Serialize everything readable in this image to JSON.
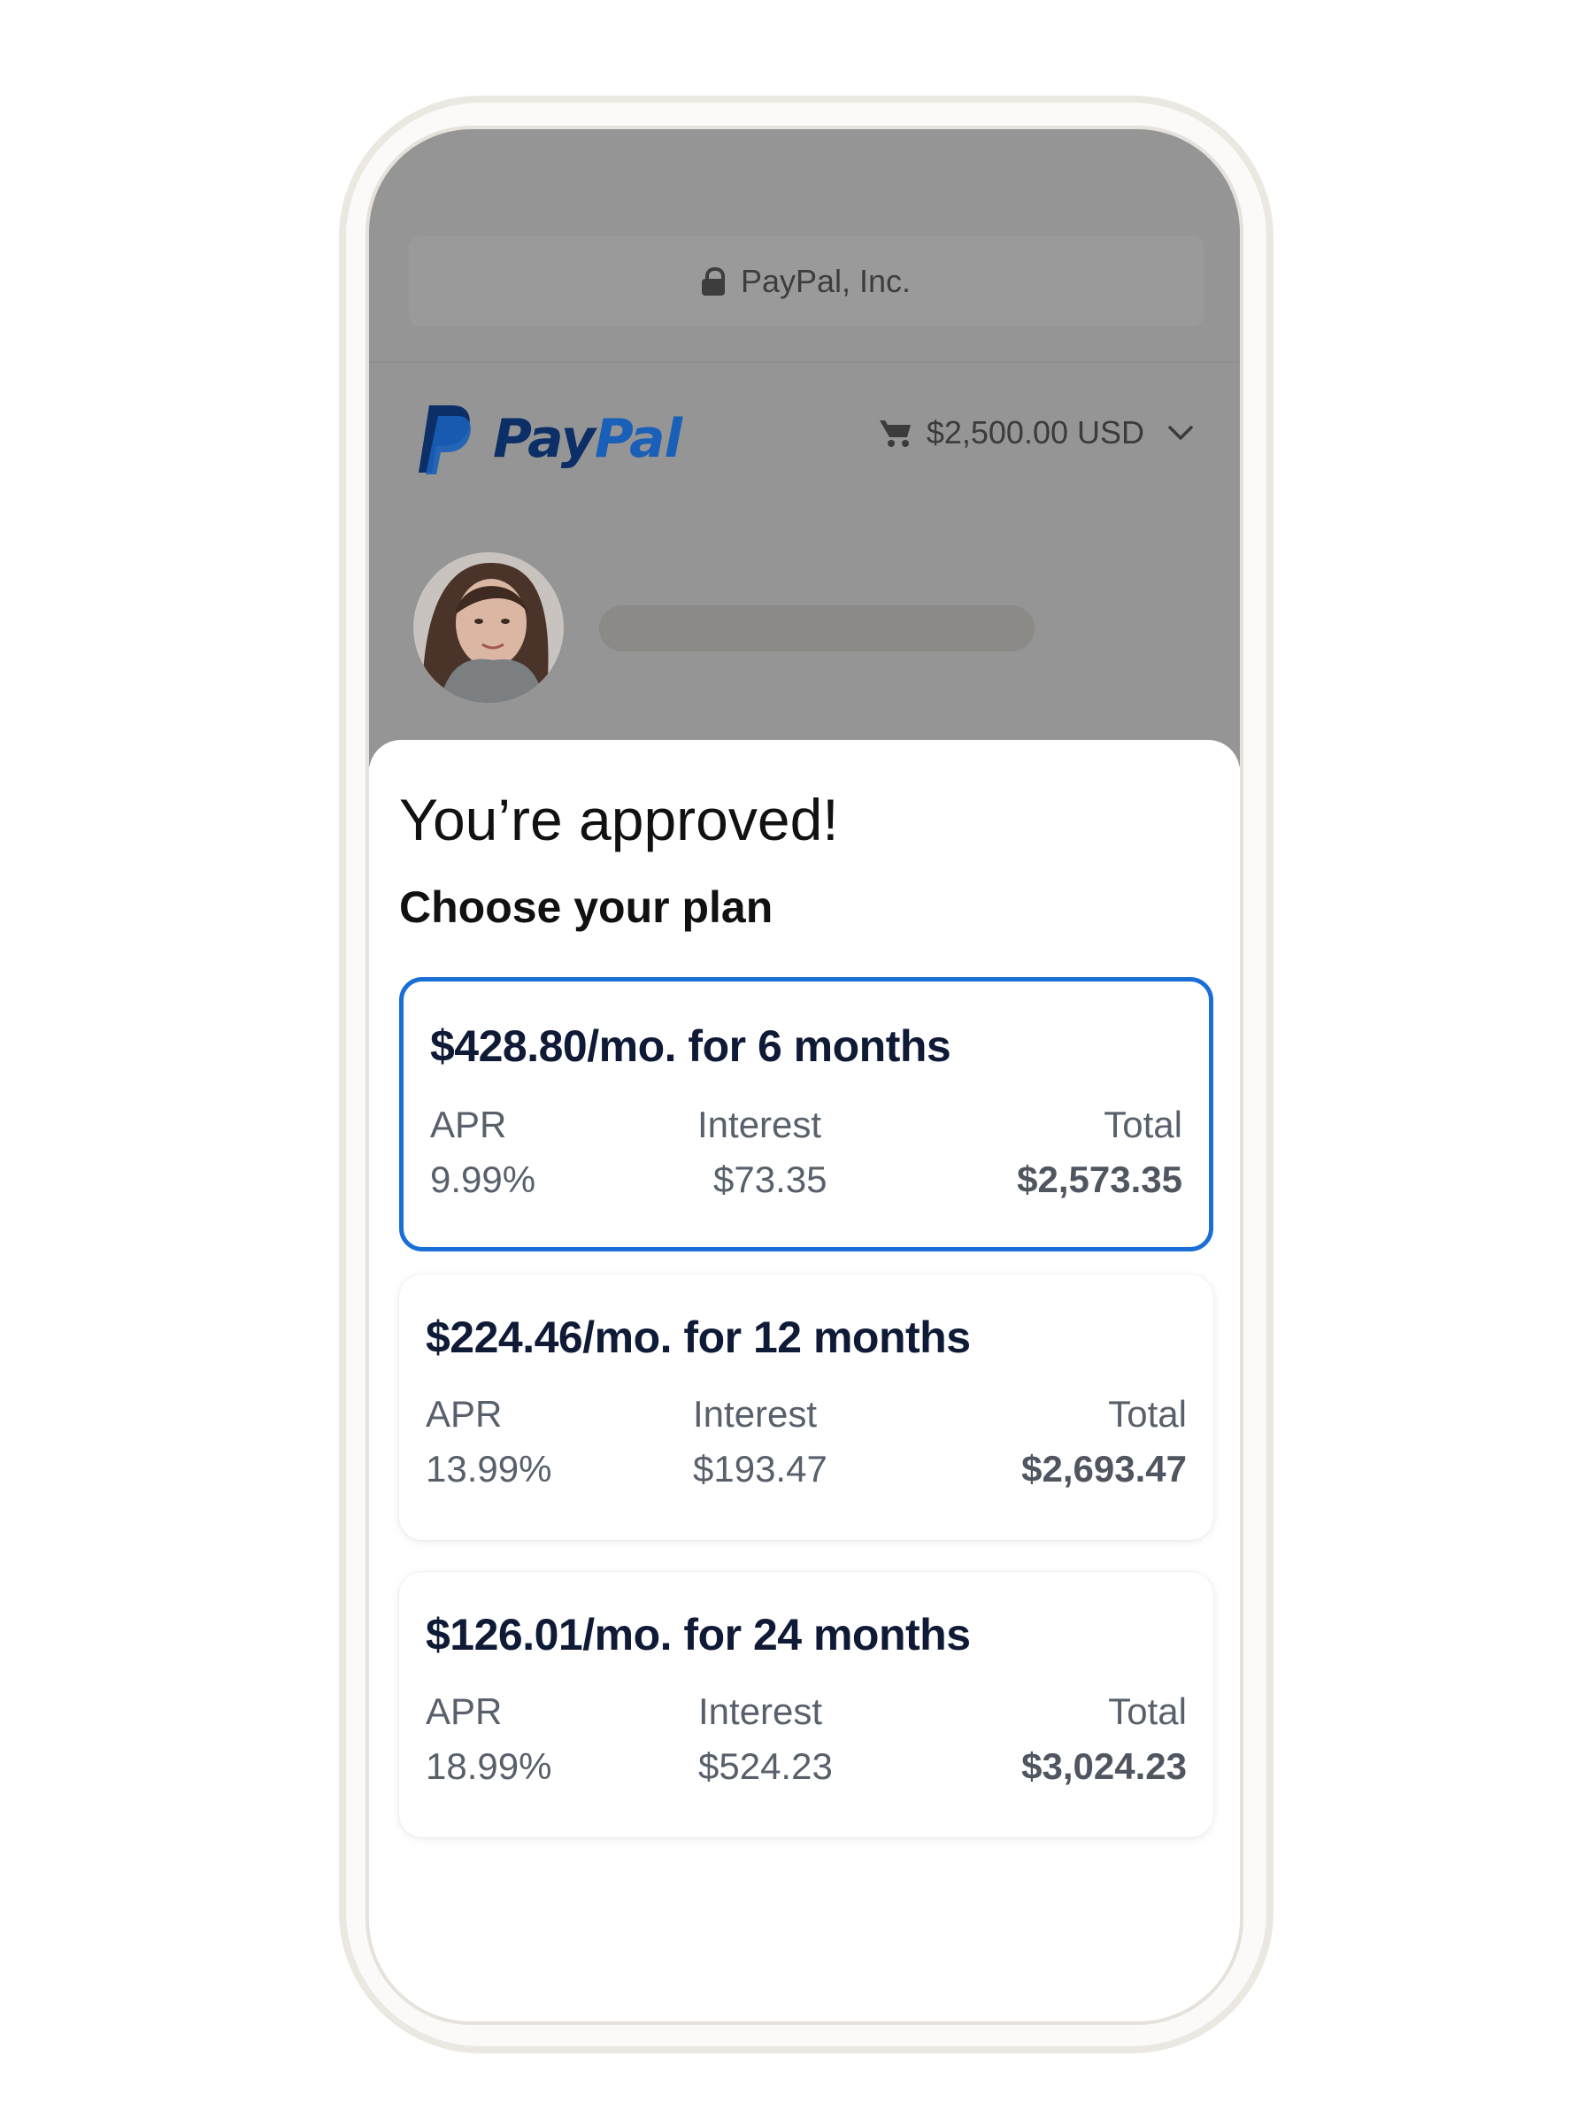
{
  "browser": {
    "url_label": "PayPal, Inc."
  },
  "header": {
    "logo_part1": "Pay",
    "logo_part2": "Pal",
    "cart_amount": "$2,500.00 USD"
  },
  "sheet": {
    "title": "You’re approved!",
    "subtitle": "Choose your plan"
  },
  "plans": [
    {
      "headline": "$428.80/mo. for 6 months",
      "apr_label": "APR",
      "apr_value": "9.99%",
      "interest_label": "Interest",
      "interest_value": "$73.35",
      "total_label": "Total",
      "total_value": "$2,573.35",
      "selected": true
    },
    {
      "headline": "$224.46/mo. for 12 months",
      "apr_label": "APR",
      "apr_value": "13.99%",
      "interest_label": "Interest",
      "interest_value": "$193.47",
      "total_label": "Total",
      "total_value": "$2,693.47",
      "selected": false
    },
    {
      "headline": "$126.01/mo. for 24 months",
      "apr_label": "APR",
      "apr_value": "18.99%",
      "interest_label": "Interest",
      "interest_value": "$524.23",
      "total_label": "Total",
      "total_value": "$3,024.23",
      "selected": false
    }
  ],
  "colors": {
    "selected_border": "#1a6fd6",
    "paypal_dark_blue": "#0b2f66",
    "paypal_light_blue": "#1a5fb8",
    "dim_overlay": "#959595"
  },
  "icons": [
    "lock-icon",
    "paypal-mark-icon",
    "cart-icon",
    "chevron-down-icon"
  ]
}
